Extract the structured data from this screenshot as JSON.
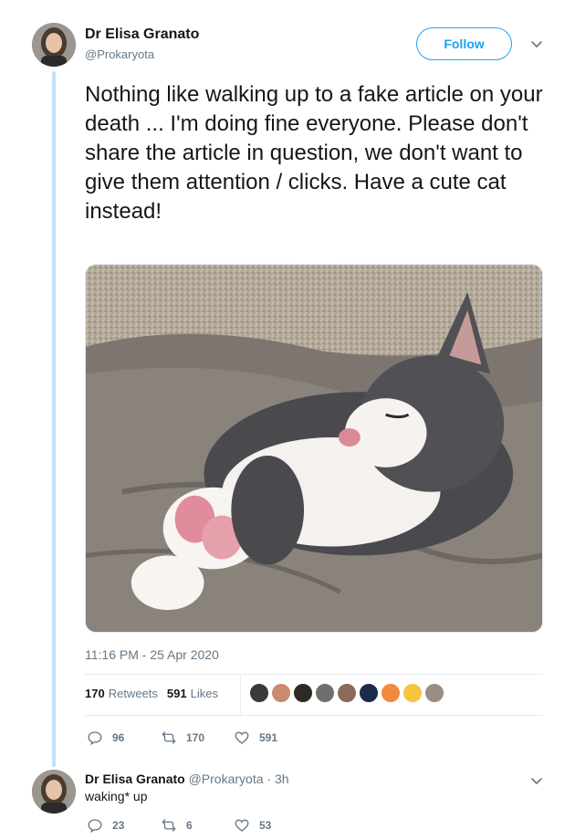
{
  "tweet": {
    "author_name": "Dr Elisa Granato",
    "author_handle": "@Prokaryota",
    "follow_label": "Follow",
    "text": "Nothing like walking up to a fake article on your death ... I'm doing fine everyone. Please don't share the article in question, we don't want to give them attention / clicks. Have a cute cat instead!",
    "timestamp": "11:16 PM - 25 Apr 2020",
    "retweets_count": "170",
    "retweets_label": "Retweets",
    "likes_count": "591",
    "likes_label": "Likes",
    "actions": {
      "replies": "96",
      "retweets": "170",
      "likes": "591"
    }
  },
  "reply": {
    "author_name": "Dr Elisa Granato",
    "author_handle": "@Prokaryota",
    "time": "· 3h",
    "text": "waking* up",
    "actions": {
      "replies": "23",
      "retweets": "6",
      "likes": "53"
    }
  },
  "colors": {
    "accent": "#1da1f2",
    "thread_line": "#c4dff6",
    "secondary_text": "#657786"
  },
  "icons": {
    "reply": "reply-icon",
    "retweet": "retweet-icon",
    "like": "heart-icon",
    "more": "chevron-down-icon"
  }
}
